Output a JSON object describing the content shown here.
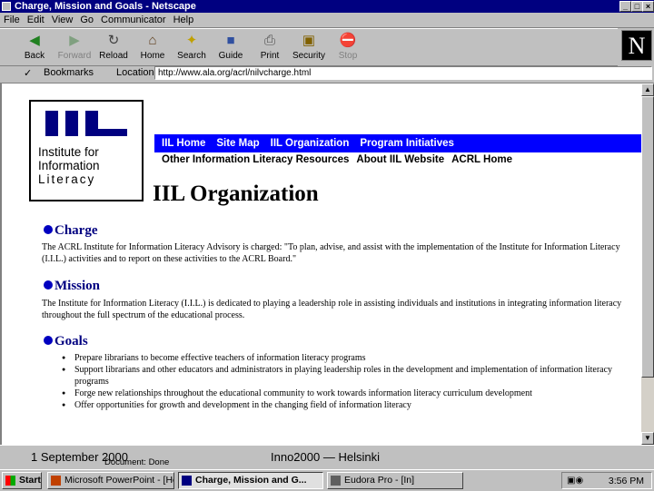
{
  "window": {
    "title": "Charge, Mission and Goals - Netscape"
  },
  "menu": [
    "File",
    "Edit",
    "View",
    "Go",
    "Communicator",
    "Help"
  ],
  "toolbar": [
    {
      "label": "Back",
      "icon": "back-arrow-icon",
      "enabled": true
    },
    {
      "label": "Forward",
      "icon": "forward-arrow-icon",
      "enabled": false
    },
    {
      "label": "Reload",
      "icon": "reload-icon",
      "enabled": true
    },
    {
      "label": "Home",
      "icon": "home-icon",
      "enabled": true
    },
    {
      "label": "Search",
      "icon": "search-icon",
      "enabled": true
    },
    {
      "label": "Guide",
      "icon": "guide-icon",
      "enabled": true
    },
    {
      "label": "Print",
      "icon": "print-icon",
      "enabled": true
    },
    {
      "label": "Security",
      "icon": "lock-icon",
      "enabled": true
    },
    {
      "label": "Stop",
      "icon": "stop-icon",
      "enabled": false
    }
  ],
  "location": {
    "bookmarks_label": "Bookmarks",
    "location_label": "Location:",
    "url": "http://www.ala.org/acrl/nilvcharge.html"
  },
  "page": {
    "logo_lines": [
      "Institute for",
      "Information",
      "Literacy"
    ],
    "nav_primary": [
      "IIL Home",
      "Site Map",
      "IIL Organization",
      "Program Initiatives"
    ],
    "nav_secondary": [
      "Other Information Literacy Resources",
      "About IIL Website",
      "ACRL Home"
    ],
    "title": "IIL Organization",
    "charge_heading": "Charge",
    "charge_text": "The ACRL Institute for Information Literacy Advisory is charged: \"To plan, advise, and assist with the implementation of the Institute for Information Literacy (I.I.L.) activities and to report on these activities to the ACRL Board.\"",
    "mission_heading": "Mission",
    "mission_text": "The Institute for Information Literacy (I.I.L.) is dedicated to playing a leadership role in assisting individuals and institutions in integrating information literacy throughout the full spectrum of the educational process.",
    "goals_heading": "Goals",
    "goals": [
      "Prepare librarians to become effective teachers of information literacy programs",
      "Support librarians and other educators and administrators in playing leadership roles in the development and implementation of information literacy programs",
      "Forge new relationships throughout the educational community to work towards information literacy curriculum development",
      "Offer opportunities for growth and development in the changing field of information literacy"
    ]
  },
  "status": {
    "text": "Document: Done"
  },
  "footer": {
    "left": "1 September 2000",
    "center": "Inno2000 — Helsinki"
  },
  "taskbar": {
    "start": "Start",
    "tasks": [
      "Microsoft PowerPoint - [He...",
      "Charge, Mission and G...",
      "Eudora Pro - [In]"
    ],
    "active_index": 1,
    "clock": "3:56 PM"
  },
  "colors": {
    "titlebar": "#000080",
    "nav_blue": "#0000ff",
    "heading": "#000080"
  }
}
